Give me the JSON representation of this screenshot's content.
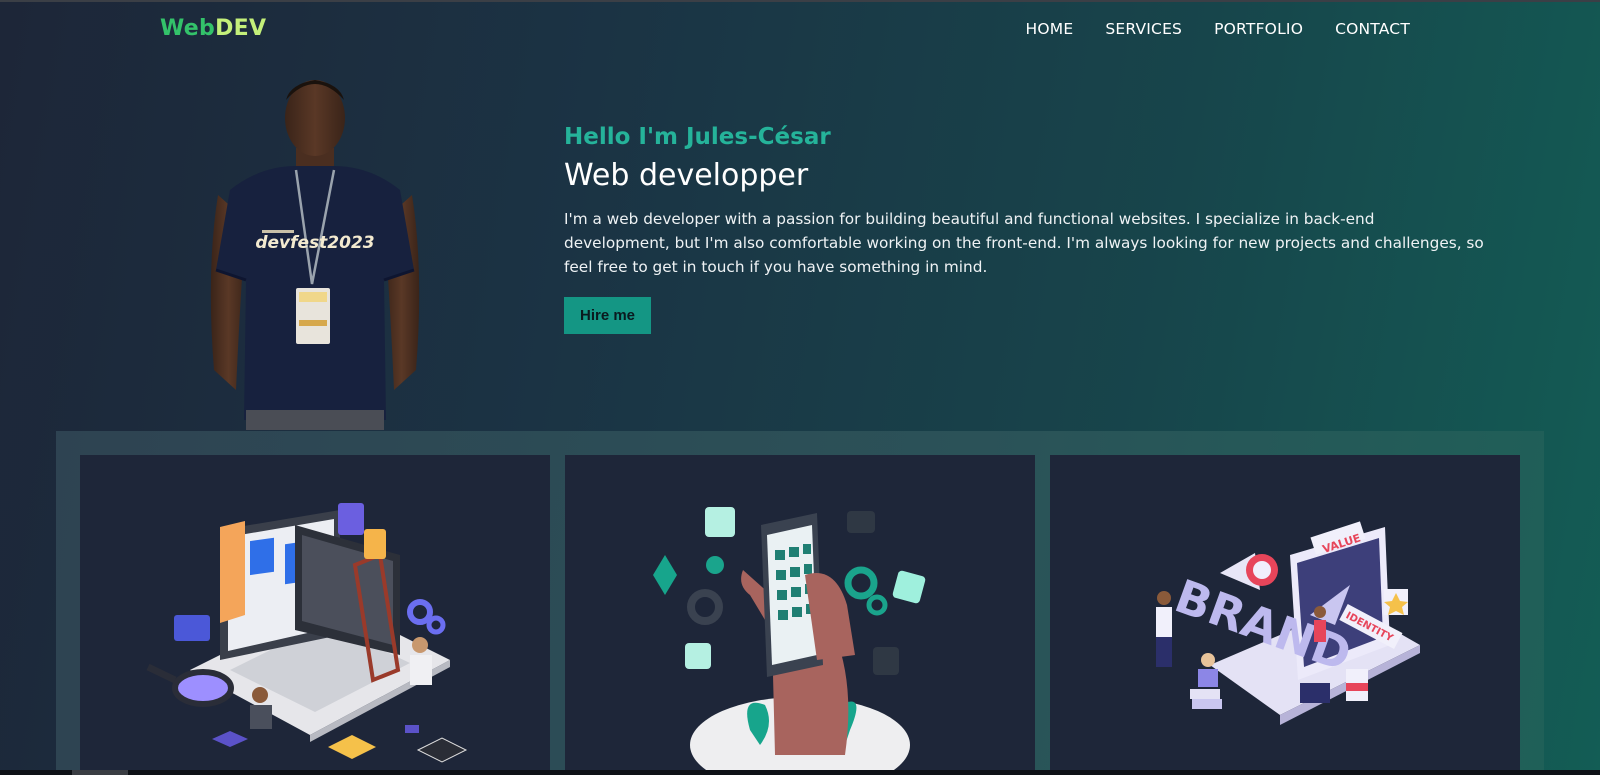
{
  "brand": {
    "part1": "Web",
    "part2": "DEV"
  },
  "nav": {
    "items": [
      "HOME",
      "SERVICES",
      "PORTFOLIO",
      "CONTACT"
    ]
  },
  "hero": {
    "greeting": "Hello I'm Jules-César",
    "role": "Web developper",
    "description": "I'm a web developer with a passion for building beautiful and functional websites. I specialize in back-end development, but I'm also comfortable working on the front-end. I'm always looking for new projects and challenges, so feel free to get in touch if you have something in mind.",
    "cta": "Hire me",
    "shirt_text": "devfest2023"
  },
  "services": {
    "cards": [
      {
        "illustration": "web-development-illustration"
      },
      {
        "illustration": "mobile-social-media-illustration"
      },
      {
        "illustration": "brand-identity-illustration",
        "labels": [
          "BRAND",
          "VALUE",
          "IDENTITY"
        ]
      }
    ]
  },
  "colors": {
    "accent": "#149684",
    "greeting": "#25b39a",
    "logo_web": "#33c26a",
    "logo_dev": "#c4f07a",
    "card_bg": "#1e2639"
  }
}
